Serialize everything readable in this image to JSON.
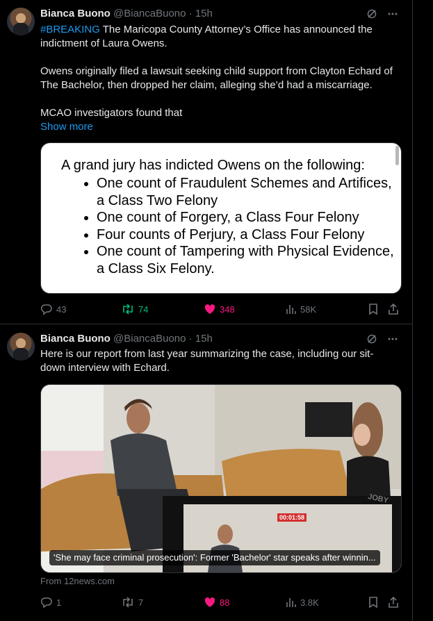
{
  "tweets": [
    {
      "author_name": "Bianca Buono",
      "handle": "@BiancaBuono",
      "separator": "·",
      "time": "15h",
      "hashtag": "#BREAKING",
      "text_lead": " The Maricopa County Attorney’s Office has announced the indictment of Laura Owens.",
      "paragraph_2": "Owens originally filed a lawsuit seeking child support from Clayton Echard of The Bachelor, then dropped her claim, alleging she’d had a miscarriage.",
      "paragraph_3": "MCAO investigators found that",
      "show_more": "Show more",
      "image": {
        "lead": "A grand jury has indicted Owens on the following:",
        "bullets": [
          "One count of Fraudulent Schemes and Artifices, a Class Two Felony",
          "One count of Forgery, a Class Four Felony",
          "Four counts of Perjury, a Class Four Felony",
          "One count of Tampering with Physical Evidence, a Class Six Felony."
        ]
      },
      "replies": "43",
      "reposts": "74",
      "likes": "348",
      "views": "58K"
    },
    {
      "author_name": "Bianca Buono",
      "handle": "@BiancaBuono",
      "separator": "·",
      "time": "15h",
      "text": "Here is our report from last year summarizing the case, including our sit-down interview with Echard.",
      "video_caption": "'She may face criminal prosecution': Former 'Bachelor' star speaks after winnin...",
      "video_timer": "00:01:58",
      "video_brand": "JOBY",
      "source": "From 12news.com",
      "replies": "1",
      "reposts": "7",
      "likes": "88",
      "views": "3.8K"
    }
  ],
  "colors": {
    "background": "#000000",
    "text": "#e7e9ea",
    "muted": "#71767b",
    "link": "#1d9bf0",
    "repost_active": "#00ba7c",
    "like_active": "#f91880",
    "border": "#2f3336"
  },
  "icons": [
    "reply-icon",
    "repost-icon",
    "like-icon",
    "views-icon",
    "bookmark-icon",
    "share-icon",
    "grok-icon",
    "more-icon"
  ]
}
